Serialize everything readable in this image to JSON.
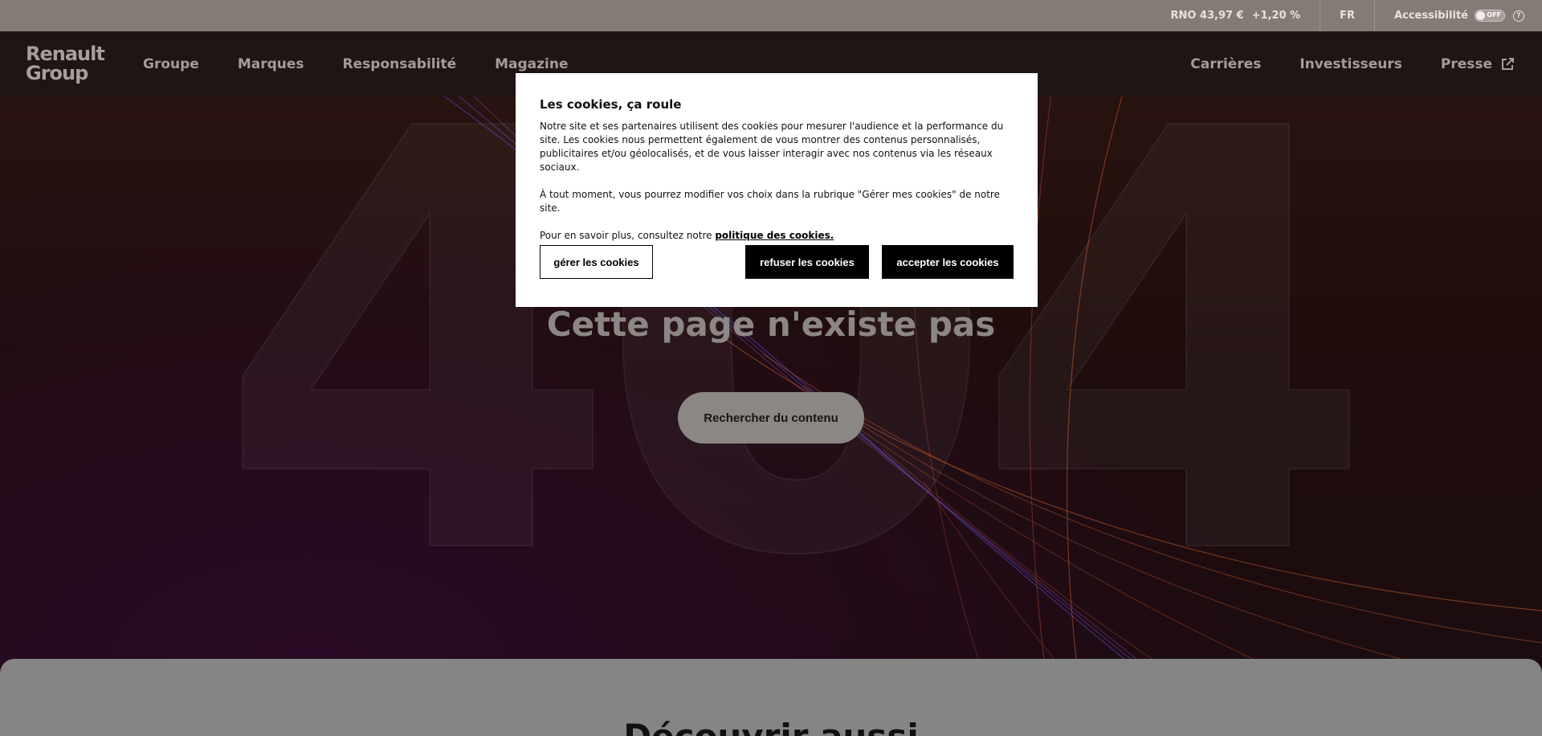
{
  "topbar": {
    "stock_label": "RNO 43,97 €",
    "stock_change": "+1,20 %",
    "language": "FR",
    "accessibility_label": "Accessibilité",
    "toggle_state": "OFF"
  },
  "nav": {
    "logo": "Renault Group",
    "left_items": [
      "Groupe",
      "Marques",
      "Responsabilité",
      "Magazine"
    ],
    "right_items": [
      "Carrières",
      "Investisseurs",
      "Presse"
    ]
  },
  "hero": {
    "big_number": "404",
    "title": "Cette page n'existe pas",
    "search_button": "Rechercher du contenu"
  },
  "bottom": {
    "heading": "Découvrir aussi"
  },
  "cookie_modal": {
    "title": "Les cookies, ça roule",
    "paragraph1": "Notre site et ses partenaires utilisent des cookies pour mesurer l'audience et la performance du site. Les cookies nous permettent également de vous montrer des contenus personnalisés, publicitaires et/ou géolocalisés, et de vous laisser interagir avec nos contenus via les réseaux sociaux.",
    "paragraph2": "À tout moment, vous pourrez modifier vos choix dans la rubrique \"Gérer mes cookies\" de notre site.",
    "paragraph3_prefix": "Pour en savoir plus, consultez notre ",
    "policy_link": "politique des cookies.",
    "manage_button": "gérer les cookies",
    "refuse_button": "refuser les cookies",
    "accept_button": "accepter les cookies"
  }
}
